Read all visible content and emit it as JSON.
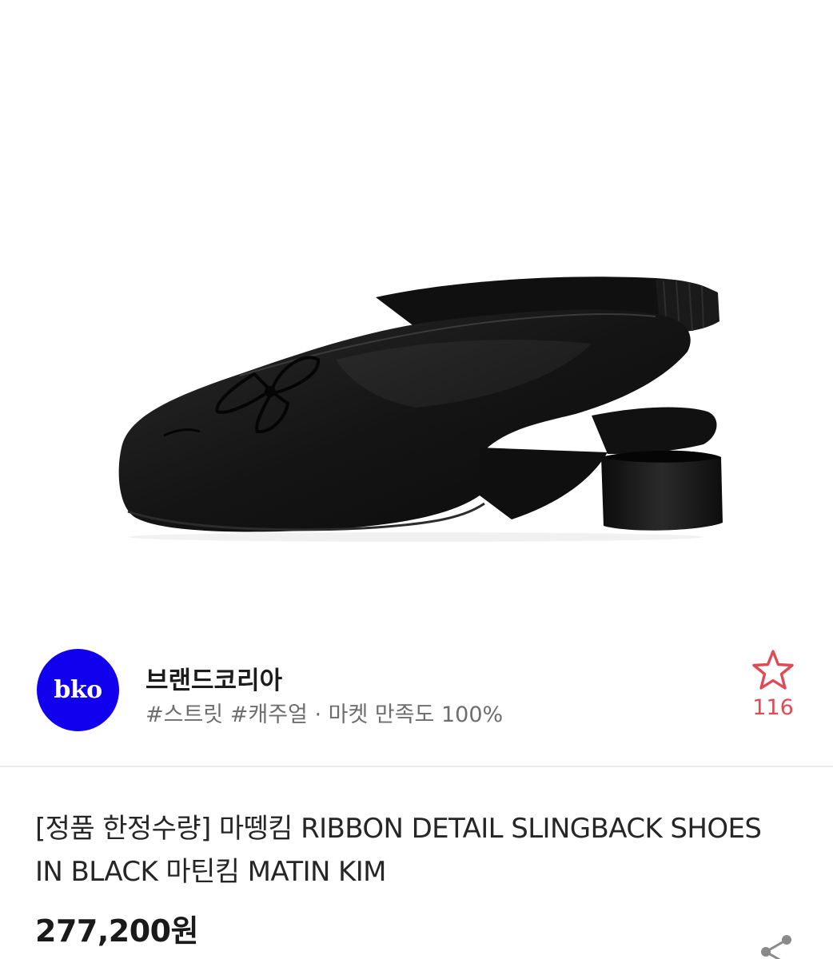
{
  "seller": {
    "avatar_text": "bko",
    "name": "브랜드코리아",
    "meta": "#스트릿 #캐주얼 · 마켓 만족도 100%",
    "favorite_count": "116"
  },
  "product": {
    "title": "[정품 한정수량] 마뗑킴 RIBBON DETAIL SLINGBACK SHOES IN BLACK 마틴킴 MATIN KIM",
    "price": "277,200원"
  },
  "colors": {
    "avatar_bg": "#1100ee",
    "favorite_accent": "#e04a55"
  },
  "icons": {
    "favorite": "star-outline-icon",
    "share": "share-icon"
  }
}
